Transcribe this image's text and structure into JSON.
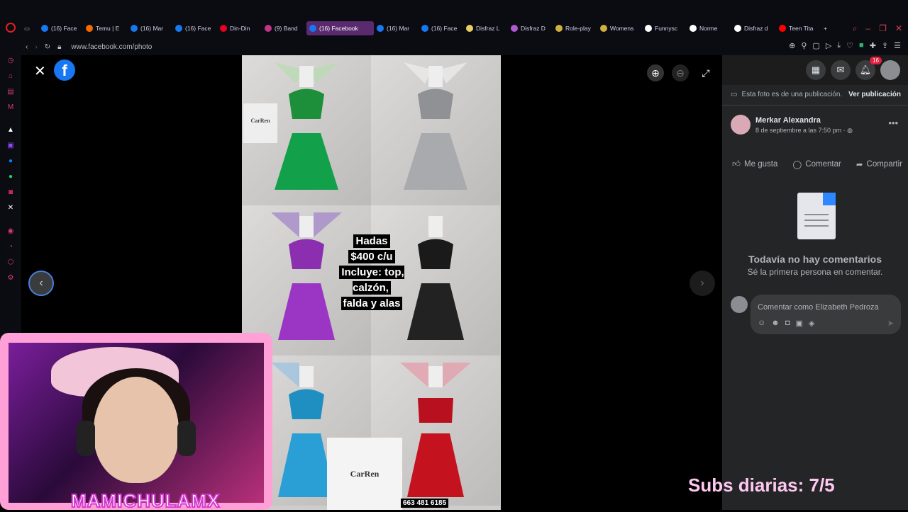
{
  "browser": {
    "tabs": [
      {
        "label": "(16) Face",
        "icon": "facebook-icon",
        "color": "#1877f2"
      },
      {
        "label": "Temu | E",
        "icon": "temu-icon",
        "color": "#f56a00"
      },
      {
        "label": "(16) Mar",
        "icon": "facebook-icon",
        "color": "#1877f2"
      },
      {
        "label": "(16) Face",
        "icon": "facebook-icon",
        "color": "#1877f2"
      },
      {
        "label": "Din-Din",
        "icon": "pinterest-icon",
        "color": "#e60023"
      },
      {
        "label": "(9) Band",
        "icon": "instagram-icon",
        "color": "#c13584"
      },
      {
        "label": "(16) Facebook",
        "icon": "facebook-icon",
        "color": "#1877f2",
        "active": true
      },
      {
        "label": "(16) Mar",
        "icon": "facebook-icon",
        "color": "#1877f2"
      },
      {
        "label": "(16) Face",
        "icon": "facebook-icon",
        "color": "#1877f2"
      },
      {
        "label": "Disfraz L",
        "icon": "shop-icon",
        "color": "#e8d060"
      },
      {
        "label": "Disfraz D",
        "icon": "shop-icon",
        "color": "#b05ad0"
      },
      {
        "label": "Role-play",
        "icon": "shop-icon",
        "color": "#d0b040"
      },
      {
        "label": "Womens",
        "icon": "shop-icon",
        "color": "#d0b040"
      },
      {
        "label": "Funnysc",
        "icon": "amazon-icon",
        "color": "#ffffff"
      },
      {
        "label": "Norme",
        "icon": "amazon-icon",
        "color": "#ffffff"
      },
      {
        "label": "Disfraz d",
        "icon": "shop-icon",
        "color": "#ffffff"
      },
      {
        "label": "Teen Tita",
        "icon": "youtube-icon",
        "color": "#ff0000"
      }
    ],
    "url": "www.facebook.com/photo"
  },
  "photo": {
    "caption_lines": [
      "Hadas",
      "$400 c/u",
      "Incluye: top, calzón,",
      "falda y alas"
    ],
    "brand": "CarRen",
    "phone": "663 481 6185"
  },
  "panel": {
    "publication_note": "Esta foto es de una publicación.",
    "view_post": "Ver publicación",
    "author": "Merkar Alexandra",
    "date": "8 de septiembre a las 7:50 pm ·",
    "notifications_count": "16",
    "actions": {
      "like": "Me gusta",
      "comment": "Comentar",
      "share": "Compartir"
    },
    "empty_title": "Todavía no hay comentarios",
    "empty_subtitle": "Sé la primera persona en comentar.",
    "comment_placeholder": "Comentar como Elizabeth Pedroza"
  },
  "overlay": {
    "streamer_name": "MAMICHULAMX",
    "subs_text": "Subs diarias: 7/5"
  }
}
